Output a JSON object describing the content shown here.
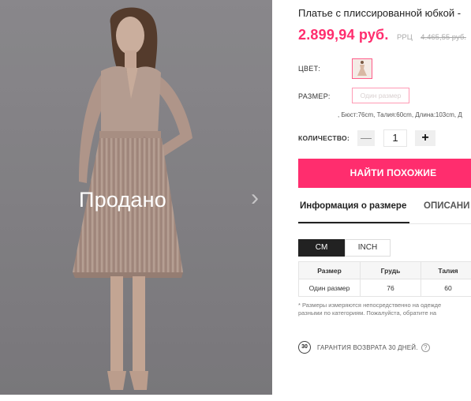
{
  "gallery": {
    "sold_label": "Продано",
    "next_icon": "chevron-right-icon"
  },
  "product": {
    "title": "Платье с плиссированной юбкой -",
    "price": "2.899,94 руб.",
    "rrp_label": "РРЦ",
    "rrp_value": "4.465,55 руб."
  },
  "options": {
    "color_label": "ЦВЕТ:",
    "size_label": "РАЗМЕР:",
    "size_value": "Один размер",
    "size_note": ", Бюст:76cm, Талия:60cm, Длина:103cm, Д",
    "quantity_label": "КОЛИЧЕСТВО:",
    "quantity_minus": "—",
    "quantity": "1",
    "quantity_plus": "+"
  },
  "actions": {
    "find_similar": "НАЙТИ ПОХОЖИЕ"
  },
  "tabs": {
    "size_info": "Информация о размере",
    "description": "ОПИСАНИ"
  },
  "units": {
    "cm": "CM",
    "inch": "INCH"
  },
  "size_table": {
    "headers": [
      "Размер",
      "Грудь",
      "Талия"
    ],
    "rows": [
      [
        "Один размер",
        "76",
        "60"
      ]
    ]
  },
  "fine_print": {
    "line1": "* Размеры измеряются непосредственно на одежде",
    "line2": "разными по категориям. Пожалуйста, обратите на"
  },
  "guarantee": {
    "badge": "30",
    "text": "ГАРАНТИЯ ВОЗВРАТА 30 ДНЕЙ.",
    "help": "?"
  },
  "colors": {
    "accent": "#ff2d6e",
    "dress": "#d2b4a0",
    "dark": "#222222"
  }
}
